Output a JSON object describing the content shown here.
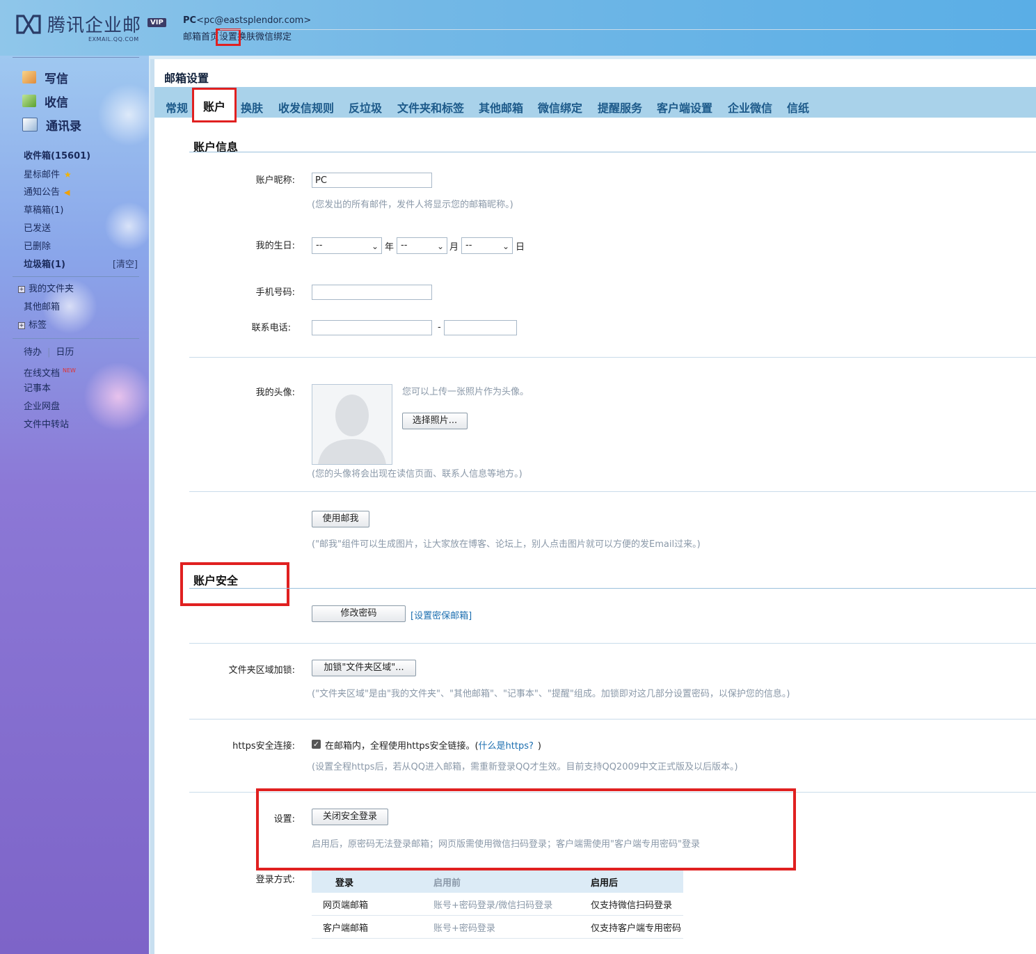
{
  "header": {
    "brand": "腾讯企业邮",
    "brand_sub": "EXMAIL.QQ.COM",
    "vip": "VIP",
    "user_name": "PC",
    "user_email": "<pc@eastsplendor.com>",
    "links": [
      "邮箱首页",
      "设置",
      "换肤",
      "微信绑定"
    ]
  },
  "sidebar": {
    "main_nav": [
      "写信",
      "收信",
      "通讯录"
    ],
    "folders": {
      "inbox": "收件箱(15601)",
      "starred": "星标邮件",
      "notice": "通知公告",
      "drafts": "草稿箱(1)",
      "sent": "已发送",
      "deleted": "已删除",
      "junk": "垃圾箱(1)",
      "clear": "[清空]"
    },
    "my_folders": "我的文件夹",
    "other_mailbox": "其他邮箱",
    "tags": "标签",
    "todo": "待办",
    "calendar": "日历",
    "online_docs": "在线文档",
    "new_tag": "NEW",
    "notes": "记事本",
    "netdisk": "企业网盘",
    "transfer": "文件中转站"
  },
  "page": {
    "title": "邮箱设置",
    "tabs": [
      "常规",
      "账户",
      "换肤",
      "收发信规则",
      "反垃圾",
      "文件夹和标签",
      "其他邮箱",
      "微信绑定",
      "提醒服务",
      "客户端设置",
      "企业微信",
      "信纸"
    ]
  },
  "account_info": {
    "heading": "账户信息",
    "nickname_label": "账户昵称:",
    "nickname_value": "PC",
    "nickname_hint": "(您发出的所有邮件，发件人将显示您的邮箱昵称。)",
    "birthday_label": "我的生日:",
    "birthday_year": "--",
    "birthday_month": "--",
    "birthday_day": "--",
    "unit_year": "年",
    "unit_month": "月",
    "unit_day": "日",
    "mobile_label": "手机号码:",
    "phone_label": "联系电话:",
    "phone_dash": "-",
    "avatar_label": "我的头像:",
    "avatar_tip": "您可以上传一张照片作为头像。",
    "choose_photo": "选择照片...",
    "avatar_hint": "(您的头像将会出现在读信页面、联系人信息等地方。)",
    "mailme_button": "使用邮我",
    "mailme_hint": "(\"邮我\"组件可以生成图片，让大家放在博客、论坛上，别人点击图片就可以方便的发Email过来。)"
  },
  "account_security": {
    "heading": "账户安全",
    "change_password": "修改密码",
    "set_security_mailbox": "[设置密保邮箱]",
    "folder_lock_label": "文件夹区域加锁:",
    "folder_lock_button": "加锁\"文件夹区域\"...",
    "folder_lock_hint": "(\"文件夹区域\"是由\"我的文件夹\"、\"其他邮箱\"、\"记事本\"、\"提醒\"组成。加锁即对这几部分设置密码，以保护您的信息。)",
    "https_label": "https安全连接:",
    "https_check": "✓",
    "https_text": "在邮箱内，全程使用https安全链接。(",
    "https_link": "什么是https?",
    "https_close": ")",
    "https_hint": "(设置全程https后，若从QQ进入邮箱，需重新登录QQ才生效。目前支持QQ2009中文正式版及以后版本。)",
    "setting_label": "设置:",
    "close_secure_login": "关闭安全登录",
    "secure_hint": "启用后，原密码无法登录邮箱；网页版需使用微信扫码登录；客户端需使用\"客户端专用密码\"登录",
    "login_method_label": "登录方式:",
    "table": {
      "headers": [
        "登录",
        "启用前",
        "启用后"
      ],
      "rows": [
        [
          "网页端邮箱",
          "账号+密码登录/微信扫码登录",
          "仅支持微信扫码登录"
        ],
        [
          "客户端邮箱",
          "账号+密码登录",
          "仅支持客户端专用密码"
        ]
      ]
    }
  }
}
